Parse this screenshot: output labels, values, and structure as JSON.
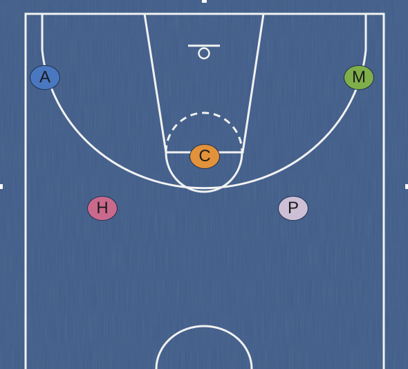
{
  "court": {
    "floor_color": "#3d5a86",
    "line_color": "#f2f2f2",
    "view": "half-court"
  },
  "players": [
    {
      "label": "A",
      "color": "#4a78c0"
    },
    {
      "label": "M",
      "color": "#7fae4a"
    },
    {
      "label": "C",
      "color": "#e2923a"
    },
    {
      "label": "H",
      "color": "#c9698c"
    },
    {
      "label": "P",
      "color": "#cdbfd6"
    }
  ]
}
